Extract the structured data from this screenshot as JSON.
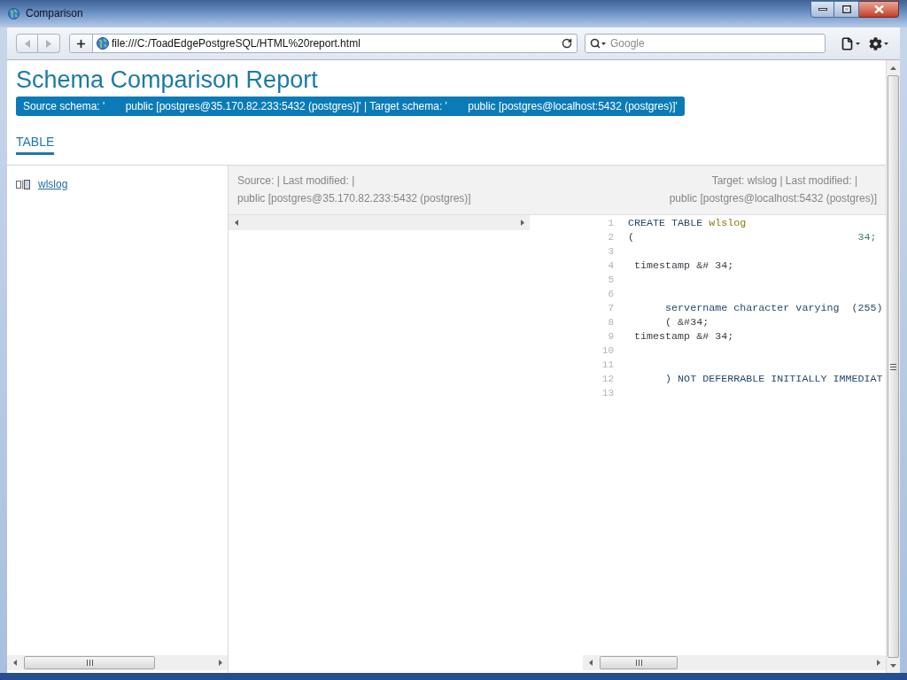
{
  "window": {
    "title": "Comparison"
  },
  "toolbar": {
    "nav_buttons": [
      {
        "kind": "back",
        "disabled": true
      },
      {
        "kind": "forward",
        "disabled": true
      }
    ],
    "address": {
      "value": "file:///C:/ToadEdgePostgreSQL/HTML%20report.html"
    },
    "search": {
      "placeholder": "Google"
    }
  },
  "report": {
    "title": "Schema Comparison Report",
    "schemas": "Source schema: '       public [postgres@35.170.82.233:5432 (postgres)]' | Target schema: '       public [postgres@localhost:5432 (postgres)]'",
    "tabs": [
      {
        "label": "TABLE",
        "selected": true
      }
    ]
  },
  "objects": [
    {
      "name": "wlslog"
    }
  ],
  "comparison": {
    "source_header": [
      "Source: | Last modified: |",
      "public [postgres@35.170.82.233:5432 (postgres)]"
    ],
    "target_header": [
      "Target: wlslog | Last modified: |",
      "public [postgres@localhost:5432 (postgres)]"
    ],
    "target_lines": [
      {
        "number": "1",
        "tokens": [
          {
            "kind": "keyword",
            "text": "CREATE TABLE"
          },
          {
            "kind": "name",
            "text": " wlslog"
          }
        ]
      },
      {
        "number": "2",
        "tokens": [
          {
            "kind": "plain",
            "text": "("
          },
          {
            "kind": "number",
            "text": "                                    34;"
          }
        ]
      },
      {
        "number": "3"
      },
      {
        "number": "4",
        "tokens": [
          {
            "kind": "plain",
            "text": " timestamp &# 34;"
          }
        ]
      },
      {
        "number": "5"
      },
      {
        "number": "6"
      },
      {
        "number": "7",
        "tokens": [
          {
            "kind": "keyword",
            "text": "      servername character varying  (255)"
          }
        ]
      },
      {
        "number": "8",
        "tokens": [
          {
            "kind": "plain",
            "text": "      ( &#34;"
          }
        ]
      },
      {
        "number": "9",
        "tokens": [
          {
            "kind": "plain",
            "text": " timestamp &# 34;"
          }
        ]
      },
      {
        "number": "10"
      },
      {
        "number": "11"
      },
      {
        "number": "12",
        "tokens": [
          {
            "kind": "keyword",
            "text": "      ) NOT DEFERRABLE INITIALLY IMMEDIAT"
          }
        ]
      },
      {
        "number": "13"
      }
    ]
  }
}
